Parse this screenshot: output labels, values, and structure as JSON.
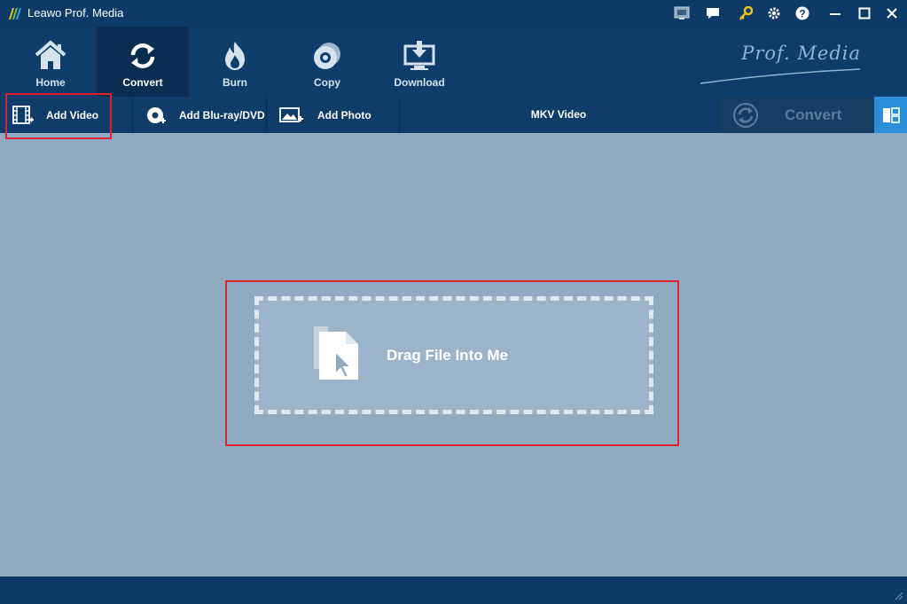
{
  "window": {
    "title": "Leawo Prof. Media"
  },
  "nav": {
    "items": [
      {
        "label": "Home",
        "icon": "home-icon"
      },
      {
        "label": "Convert",
        "icon": "convert-icon",
        "active": true
      },
      {
        "label": "Burn",
        "icon": "burn-icon"
      },
      {
        "label": "Copy",
        "icon": "copy-disc-icon"
      },
      {
        "label": "Download",
        "icon": "download-icon"
      }
    ],
    "brand": "Prof. Media"
  },
  "toolbar": {
    "add_video": "Add Video",
    "add_bluray": "Add Blu-ray/DVD",
    "add_photo": "Add Photo",
    "format": "MKV Video",
    "convert": "Convert"
  },
  "main": {
    "drop_label": "Drag File Into Me"
  },
  "colors": {
    "titlebar": "#0d3a66",
    "nav_active": "#0a2e52",
    "content_bg": "#8faac1",
    "accent_blue": "#2c8ed9",
    "highlight_red": "#e0202c"
  }
}
